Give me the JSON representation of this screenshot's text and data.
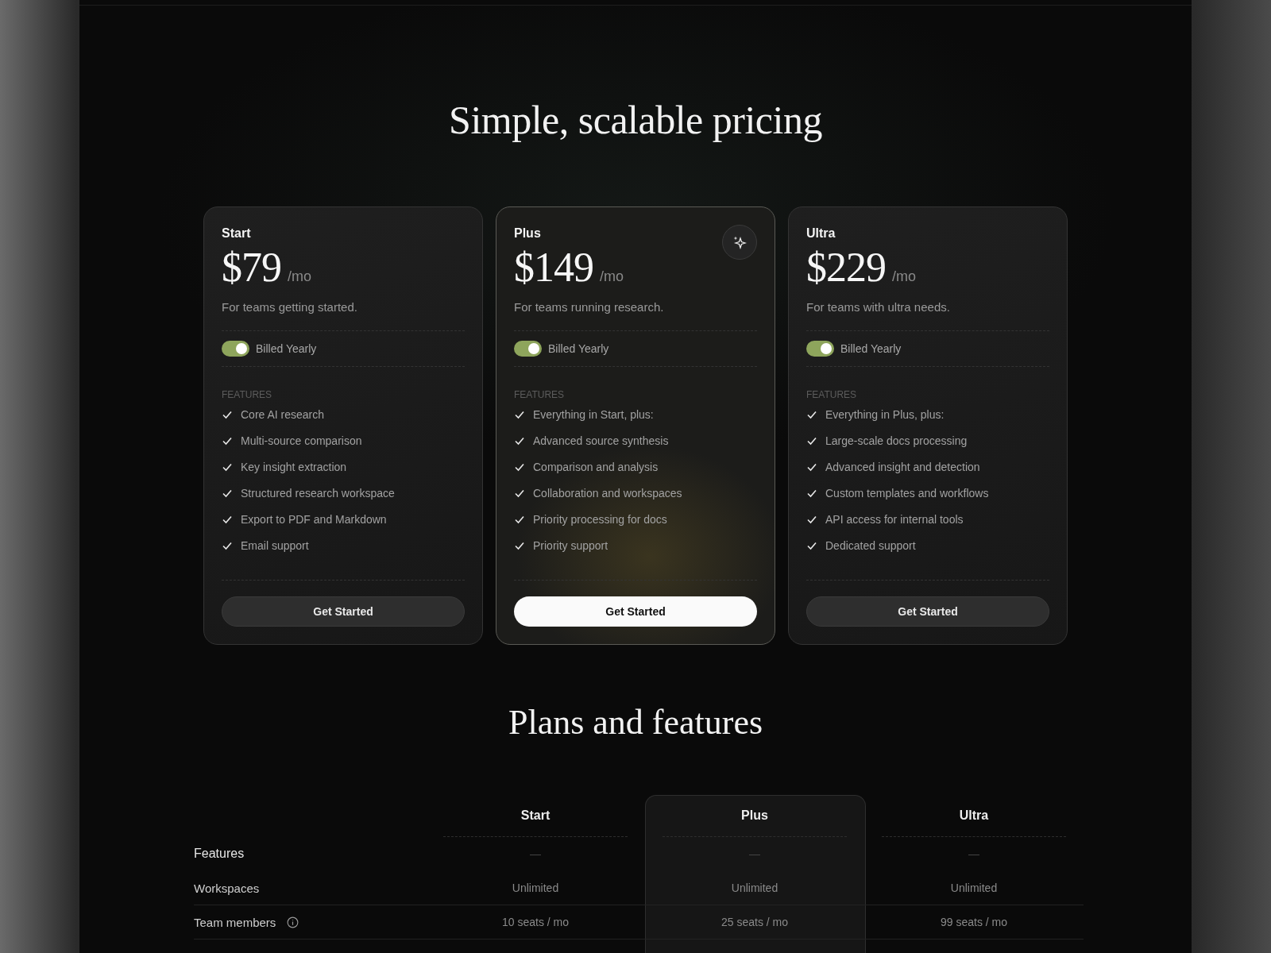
{
  "heading": "Simple, scalable pricing",
  "plans": [
    {
      "name": "Start",
      "price": "$79",
      "period": "/mo",
      "description": "For teams getting started.",
      "highlighted": false,
      "billing": {
        "label": "Billed Yearly",
        "on": true
      },
      "features_heading": "FEATURES",
      "features": [
        "Core AI research",
        "Multi-source comparison",
        "Key insight extraction",
        "Structured research workspace",
        "Export to PDF and Markdown",
        "Email support"
      ],
      "button": {
        "label": "Get Started",
        "kind": "secondary"
      }
    },
    {
      "name": "Plus",
      "price": "$149",
      "period": "/mo",
      "description": "For teams running research.",
      "highlighted": true,
      "billing": {
        "label": "Billed Yearly",
        "on": true
      },
      "features_heading": "FEATURES",
      "features": [
        "Everything in Start, plus:",
        "Advanced source synthesis",
        "Comparison and analysis",
        "Collaboration and workspaces",
        "Priority processing for docs",
        "Priority support"
      ],
      "button": {
        "label": "Get Started",
        "kind": "primary"
      }
    },
    {
      "name": "Ultra",
      "price": "$229",
      "period": "/mo",
      "description": "For teams with ultra needs.",
      "highlighted": false,
      "billing": {
        "label": "Billed Yearly",
        "on": true
      },
      "features_heading": "FEATURES",
      "features": [
        "Everything in Plus, plus:",
        "Large-scale docs processing",
        "Advanced insight and detection",
        "Custom templates and workflows",
        "API access for internal tools",
        "Dedicated support"
      ],
      "button": {
        "label": "Get Started",
        "kind": "secondary"
      }
    }
  ],
  "comparison": {
    "heading": "Plans and features",
    "columns": [
      {
        "label": "Start",
        "highlighted": false
      },
      {
        "label": "Plus",
        "highlighted": true
      },
      {
        "label": "Ultra",
        "highlighted": false
      }
    ],
    "rows": [
      {
        "label": "Features",
        "kind": "section",
        "info": false,
        "values": [
          "—",
          "—",
          "—"
        ]
      },
      {
        "label": "Workspaces",
        "kind": "item",
        "info": false,
        "values": [
          "Unlimited",
          "Unlimited",
          "Unlimited"
        ]
      },
      {
        "label": "Team members",
        "kind": "item",
        "info": true,
        "values": [
          "10 seats / mo",
          "25 seats / mo",
          "99 seats / mo"
        ]
      }
    ]
  }
}
